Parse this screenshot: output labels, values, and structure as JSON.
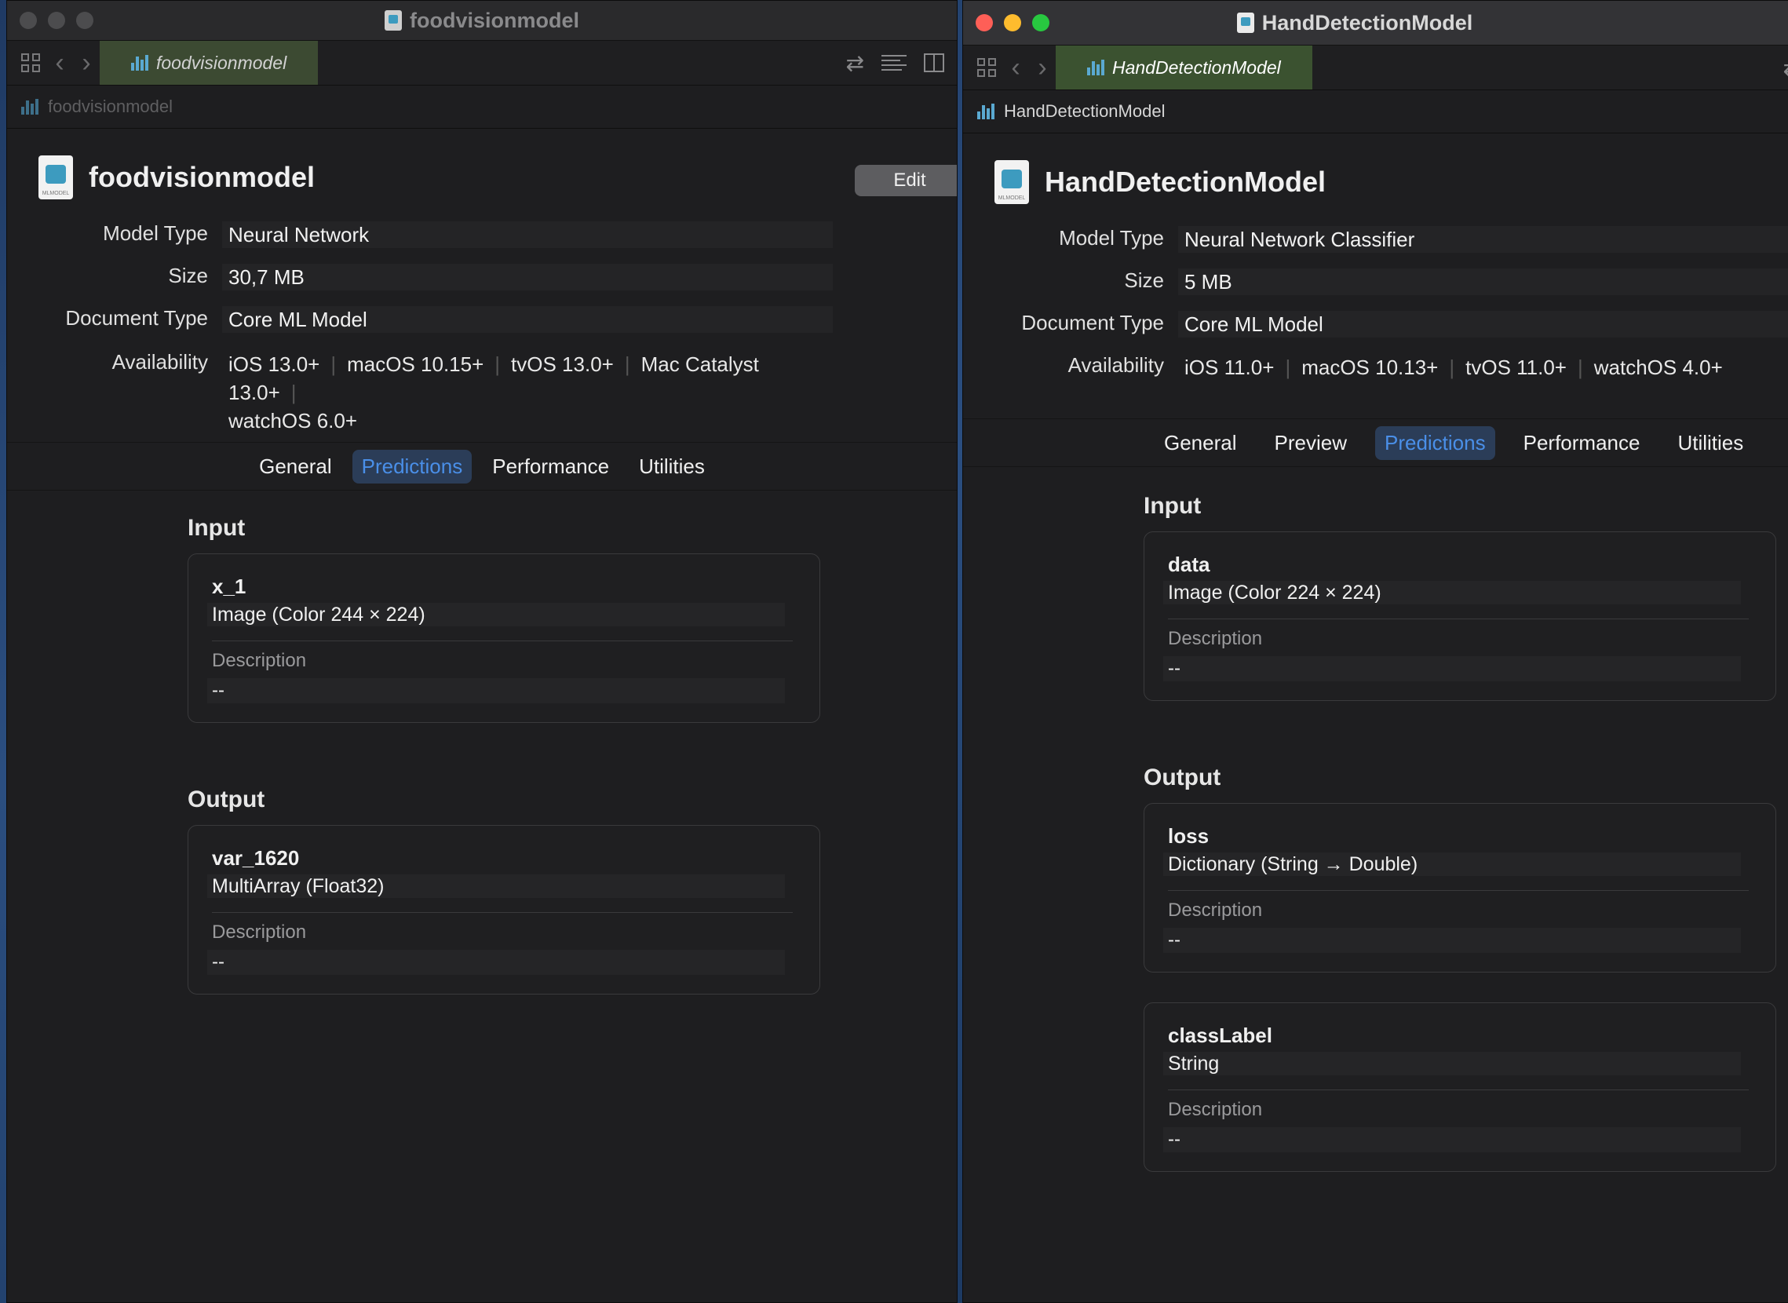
{
  "left": {
    "window_title": "foodvisionmodel",
    "tab_label": "foodvisionmodel",
    "jump_label": "foodvisionmodel",
    "model_name": "foodvisionmodel",
    "edit_label": "Edit",
    "meta": {
      "model_type_label": "Model Type",
      "model_type": "Neural Network",
      "size_label": "Size",
      "size": "30,7 MB",
      "doc_type_label": "Document Type",
      "doc_type": "Core ML Model",
      "availability_label": "Availability",
      "availability": [
        "iOS 13.0+",
        "macOS 10.15+",
        "tvOS 13.0+",
        "Mac Catalyst 13.0+",
        "watchOS 6.0+"
      ]
    },
    "tabs": [
      "General",
      "Predictions",
      "Performance",
      "Utilities"
    ],
    "active_tab": "Predictions",
    "input_title": "Input",
    "output_title": "Output",
    "inputs": [
      {
        "name": "x_1",
        "type": "Image (Color 244 × 224)",
        "desc_label": "Description",
        "desc": "--"
      }
    ],
    "outputs": [
      {
        "name": "var_1620",
        "type": "MultiArray (Float32)",
        "desc_label": "Description",
        "desc": "--"
      }
    ]
  },
  "right": {
    "window_title": "HandDetectionModel",
    "tab_label": "HandDetectionModel",
    "jump_label": "HandDetectionModel",
    "model_name": "HandDetectionModel",
    "meta": {
      "model_type_label": "Model Type",
      "model_type": "Neural Network Classifier",
      "size_label": "Size",
      "size": "5 MB",
      "doc_type_label": "Document Type",
      "doc_type": "Core ML Model",
      "availability_label": "Availability",
      "availability": [
        "iOS 11.0+",
        "macOS 10.13+",
        "tvOS 11.0+",
        "watchOS 4.0+"
      ]
    },
    "tabs": [
      "General",
      "Preview",
      "Predictions",
      "Performance",
      "Utilities"
    ],
    "active_tab": "Predictions",
    "input_title": "Input",
    "output_title": "Output",
    "inputs": [
      {
        "name": "data",
        "type": "Image (Color 224 × 224)",
        "desc_label": "Description",
        "desc": "--"
      }
    ],
    "outputs": [
      {
        "name": "loss",
        "type": "Dictionary (String → Double)",
        "desc_label": "Description",
        "desc": "--"
      },
      {
        "name": "classLabel",
        "type": "String",
        "desc_label": "Description",
        "desc": "--"
      }
    ]
  },
  "colors": {
    "accent": "#4a8fe8",
    "tab_highlight": "#3c4a32",
    "close": "#fe5f57",
    "minimize": "#febc2e",
    "zoom": "#28c840"
  },
  "icons": [
    "grid-icon",
    "chevron-left-icon",
    "chevron-right-icon",
    "swap-icon",
    "lines-icon",
    "split-icon",
    "mlmodel-icon"
  ]
}
